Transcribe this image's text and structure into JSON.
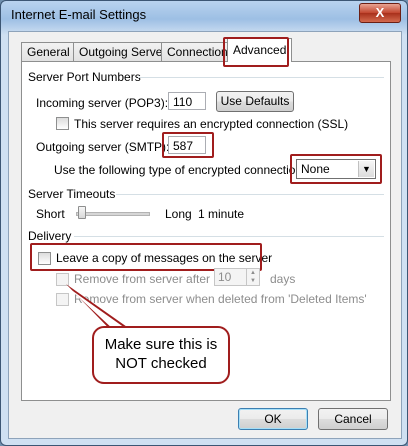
{
  "window": {
    "title": "Internet E-mail Settings",
    "close_glyph": "X"
  },
  "tabs": [
    {
      "label": "General"
    },
    {
      "label": "Outgoing Server"
    },
    {
      "label": "Connection"
    },
    {
      "label": "Advanced"
    }
  ],
  "server_ports": {
    "group_title": "Server Port Numbers",
    "incoming_label": "Incoming server (POP3):",
    "incoming_value": "110",
    "use_defaults_label": "Use Defaults",
    "ssl_label": "This server requires an encrypted connection (SSL)",
    "outgoing_label": "Outgoing server (SMTP):",
    "outgoing_value": "587",
    "encryption_label": "Use the following type of encrypted connection:",
    "encryption_value": "None"
  },
  "timeouts": {
    "group_title": "Server Timeouts",
    "short_label": "Short",
    "long_label": "Long",
    "value_text": "1 minute",
    "slider_level": 0.03
  },
  "delivery": {
    "group_title": "Delivery",
    "leave_copy_label": "Leave a copy of messages on the server",
    "remove_after_label": "Remove from server after",
    "days_value": "10",
    "days_label": "days",
    "remove_deleted_label": "Remove from server when deleted from 'Deleted Items'"
  },
  "callout": {
    "line1": "Make sure this is",
    "line2": "NOT checked"
  },
  "footer": {
    "ok_label": "OK",
    "cancel_label": "Cancel"
  }
}
